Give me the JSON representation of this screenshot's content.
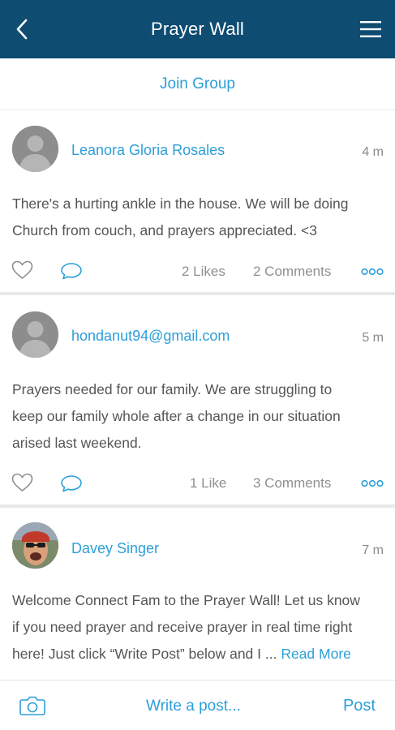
{
  "header": {
    "title": "Prayer Wall",
    "back_icon": "chevron-left-icon",
    "menu_icon": "hamburger-menu-icon"
  },
  "join_group": {
    "label": "Join Group"
  },
  "posts": [
    {
      "author": "Leanora Gloria Rosales",
      "time": "4 m",
      "text_lines": [
        "There's a hurting ankle in the house. We will be doing",
        "Church from couch, and prayers appreciated. <3"
      ],
      "likes": "2 Likes",
      "comments": "2 Comments"
    },
    {
      "author": "hondanut94@gmail.com",
      "time": "5 m",
      "text_lines": [
        "Prayers needed for our family. We are struggling to",
        "keep our family whole after a change in our situation",
        "arised last weekend."
      ],
      "likes": "1 Like",
      "comments": "3 Comments"
    },
    {
      "author": "Davey Singer",
      "time": "7 m",
      "text_lines": [
        "Welcome Connect Fam to the Prayer Wall! Let us know",
        "if you need prayer and receive prayer in real time right",
        "here! Just click “Write Post” below and I ... "
      ],
      "read_more": "Read More"
    }
  ],
  "composer": {
    "camera_icon": "camera-icon",
    "placeholder": "Write a post...",
    "post_label": "Post"
  },
  "colors": {
    "header_bg": "#0f4c72",
    "accent": "#2d9fd8",
    "text": "#555555",
    "muted": "#8f8f8f"
  }
}
